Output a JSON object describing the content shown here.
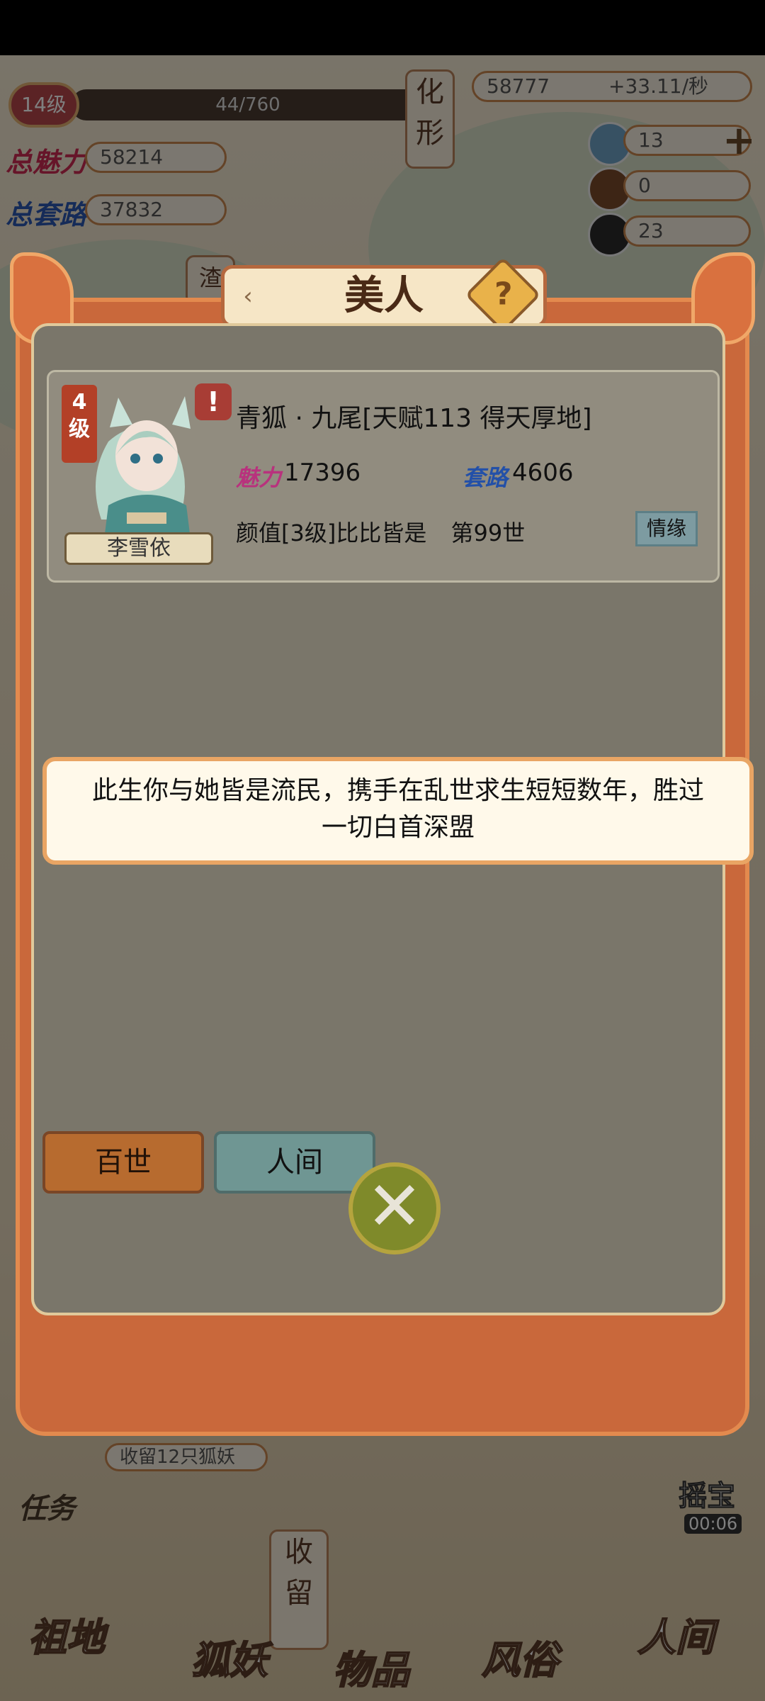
{
  "hud": {
    "level": "14级",
    "xp": "44/760",
    "total_charm_label": "总魅力",
    "total_charm": "58214",
    "total_tricks_label": "总套路",
    "total_tricks": "37832",
    "side_tab": "化形",
    "gold": "58777",
    "gold_rate": "+33.11/秒",
    "res1": "13",
    "res2": "0",
    "res3": "23",
    "left_tab": "渣"
  },
  "bottom": {
    "shelter_progress": "收留12只狐妖",
    "task_label": "任务",
    "shelter_tab": "收留",
    "timer": "00:06",
    "timer_label": "摇宝",
    "nav": [
      "祖地",
      "狐妖",
      "物品",
      "风俗",
      "人间"
    ]
  },
  "dialog": {
    "title": "美人",
    "help": "?",
    "arrow_left": "‹",
    "arrow_right": "›",
    "card": {
      "level_num": "4",
      "level_unit": "级",
      "warning": "!",
      "name": "李雪依",
      "title": "青狐 · 九尾[天赋113 得天厚地]",
      "charm_label": "魅力",
      "charm": "17396",
      "tricks_label": "套路",
      "tricks": "4606",
      "looks": "颜值[3级]比比皆是",
      "life": "第99世",
      "fate_button": "情缘"
    },
    "story_line1": "此生你与她皆是流民，携手在乱世求生短短数年，胜过",
    "story_line2": "一切白首深盟",
    "tabs": {
      "baishi": "百世",
      "renjian": "人间"
    },
    "close": "✕"
  }
}
